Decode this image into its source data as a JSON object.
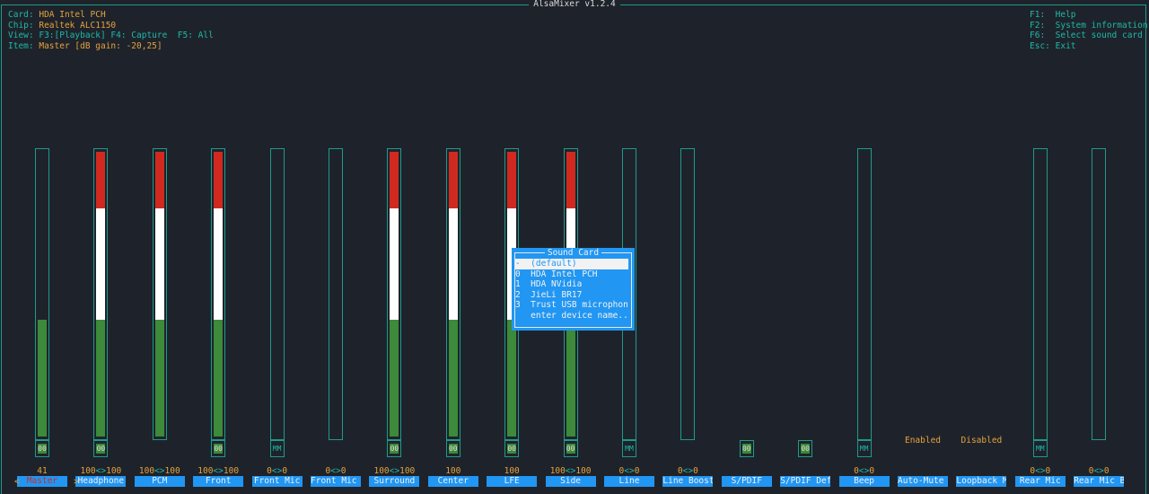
{
  "window_title": "AlsaMixer v1.2.4",
  "info": {
    "card_label": "Card:",
    "card_value": "HDA Intel PCH",
    "chip_label": "Chip:",
    "chip_value": "Realtek ALC1150",
    "view_label": "View:",
    "view_value": "F3:[Playback] F4: Capture  F5: All",
    "item_label": "Item:",
    "item_value": "Master [dB gain: -20,25]"
  },
  "help": [
    {
      "key": "F1:",
      "text": "Help"
    },
    {
      "key": "F2:",
      "text": "System information"
    },
    {
      "key": "F6:",
      "text": "Select sound card"
    },
    {
      "key": "Esc:",
      "text": "Exit"
    }
  ],
  "colors": {
    "accent": "#2196f3",
    "border": "#1f9a8a",
    "text": "#e6a23c",
    "green": "#3c8a3a",
    "red": "#d02a20"
  },
  "nav": {
    "left": "<",
    "right": ">"
  },
  "controls": [
    {
      "name": "Master",
      "volume": "41",
      "level": 0.41,
      "switch": "00",
      "selected": true
    },
    {
      "name": "Headphone",
      "volume": "100<>100",
      "level": 1.0,
      "switch": "00"
    },
    {
      "name": "PCM",
      "volume": "100<>100",
      "level": 1.0,
      "switch": null
    },
    {
      "name": "Front",
      "volume": "100<>100",
      "level": 1.0,
      "switch": "00"
    },
    {
      "name": "Front Mic",
      "volume": "0<>0",
      "level": 0,
      "switch": "MM"
    },
    {
      "name": "Front Mic B",
      "volume": "0<>0",
      "level": 0,
      "switch": null
    },
    {
      "name": "Surround",
      "volume": "100<>100",
      "level": 1.0,
      "switch": "00"
    },
    {
      "name": "Center",
      "volume": "100",
      "level": 1.0,
      "switch": "00"
    },
    {
      "name": "LFE",
      "volume": "100",
      "level": 1.0,
      "switch": "00"
    },
    {
      "name": "Side",
      "volume": "100<>100",
      "level": 1.0,
      "switch": "00"
    },
    {
      "name": "Line",
      "volume": "0<>0",
      "level": 0,
      "switch": "MM"
    },
    {
      "name": "Line Boost",
      "volume": "0<>0",
      "level": 0,
      "switch": null
    },
    {
      "name": "S/PDIF",
      "volume": "",
      "level": null,
      "switch": "00"
    },
    {
      "name": "S/PDIF Defa",
      "volume": "",
      "level": null,
      "switch": "00"
    },
    {
      "name": "Beep",
      "volume": "0<>0",
      "level": 0,
      "switch": "MM"
    },
    {
      "name": "Auto-Mute M",
      "volume": "",
      "level": null,
      "switch": null,
      "enum": "Enabled"
    },
    {
      "name": "Loopback Mi",
      "volume": "",
      "level": null,
      "switch": null,
      "enum": "Disabled"
    },
    {
      "name": "Rear Mic",
      "volume": "0<>0",
      "level": 0,
      "switch": "MM"
    },
    {
      "name": "Rear Mic Bo",
      "volume": "0<>0",
      "level": 0,
      "switch": null
    }
  ],
  "dialog": {
    "title": "Sound Card",
    "items": [
      {
        "label": "-  (default)",
        "selected": true
      },
      {
        "label": "0  HDA Intel PCH"
      },
      {
        "label": "1  HDA NVidia"
      },
      {
        "label": "2  JieLi BR17"
      },
      {
        "label": "3  Trust USB microphone"
      },
      {
        "label": "   enter device name..."
      }
    ]
  }
}
